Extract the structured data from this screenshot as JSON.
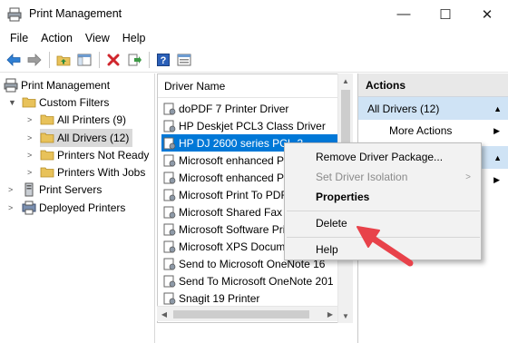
{
  "window": {
    "title": "Print Management",
    "minimize_glyph": "—",
    "maximize_glyph": "☐",
    "close_glyph": "✕"
  },
  "menu": [
    "File",
    "Action",
    "View",
    "Help"
  ],
  "toolbar": {
    "icons": [
      "back-arrow-icon",
      "forward-arrow-icon",
      "up-folder-icon",
      "show-hide-tree-icon",
      "delete-icon",
      "export-list-icon",
      "help-icon",
      "properties-icon"
    ]
  },
  "tree": {
    "root": "Print Management",
    "custom_filters": "Custom Filters",
    "all_printers": "All Printers (9)",
    "all_drivers": "All Drivers (12)",
    "printers_not_ready": "Printers Not Ready",
    "printers_with_jobs": "Printers With Jobs",
    "print_servers": "Print Servers",
    "deployed_printers": "Deployed Printers"
  },
  "list": {
    "column_header": "Driver Name",
    "rows": [
      "doPDF 7 Printer Driver",
      "HP Deskjet PCL3 Class Driver",
      "HP DJ 2600 series PCL-3",
      "Microsoft enhanced P",
      "Microsoft enhanced P",
      "Microsoft Print To PDF",
      "Microsoft Shared Fax I",
      "Microsoft Software Pri",
      "Microsoft XPS Docum",
      "Send to Microsoft OneNote 16",
      "Send To Microsoft OneNote 201",
      "Snagit 19 Printer"
    ],
    "selected_index": 2
  },
  "actions": {
    "title": "Actions",
    "group1": "All Drivers (12)",
    "more_actions": "More Actions"
  },
  "context_menu": {
    "remove_driver_package": "Remove Driver Package...",
    "set_driver_isolation": "Set Driver Isolation",
    "properties": "Properties",
    "delete": "Delete",
    "help": "Help"
  },
  "colors": {
    "selection": "#0078d7",
    "actions_group": "#cfe3f5",
    "arrow": "#e8424a"
  }
}
